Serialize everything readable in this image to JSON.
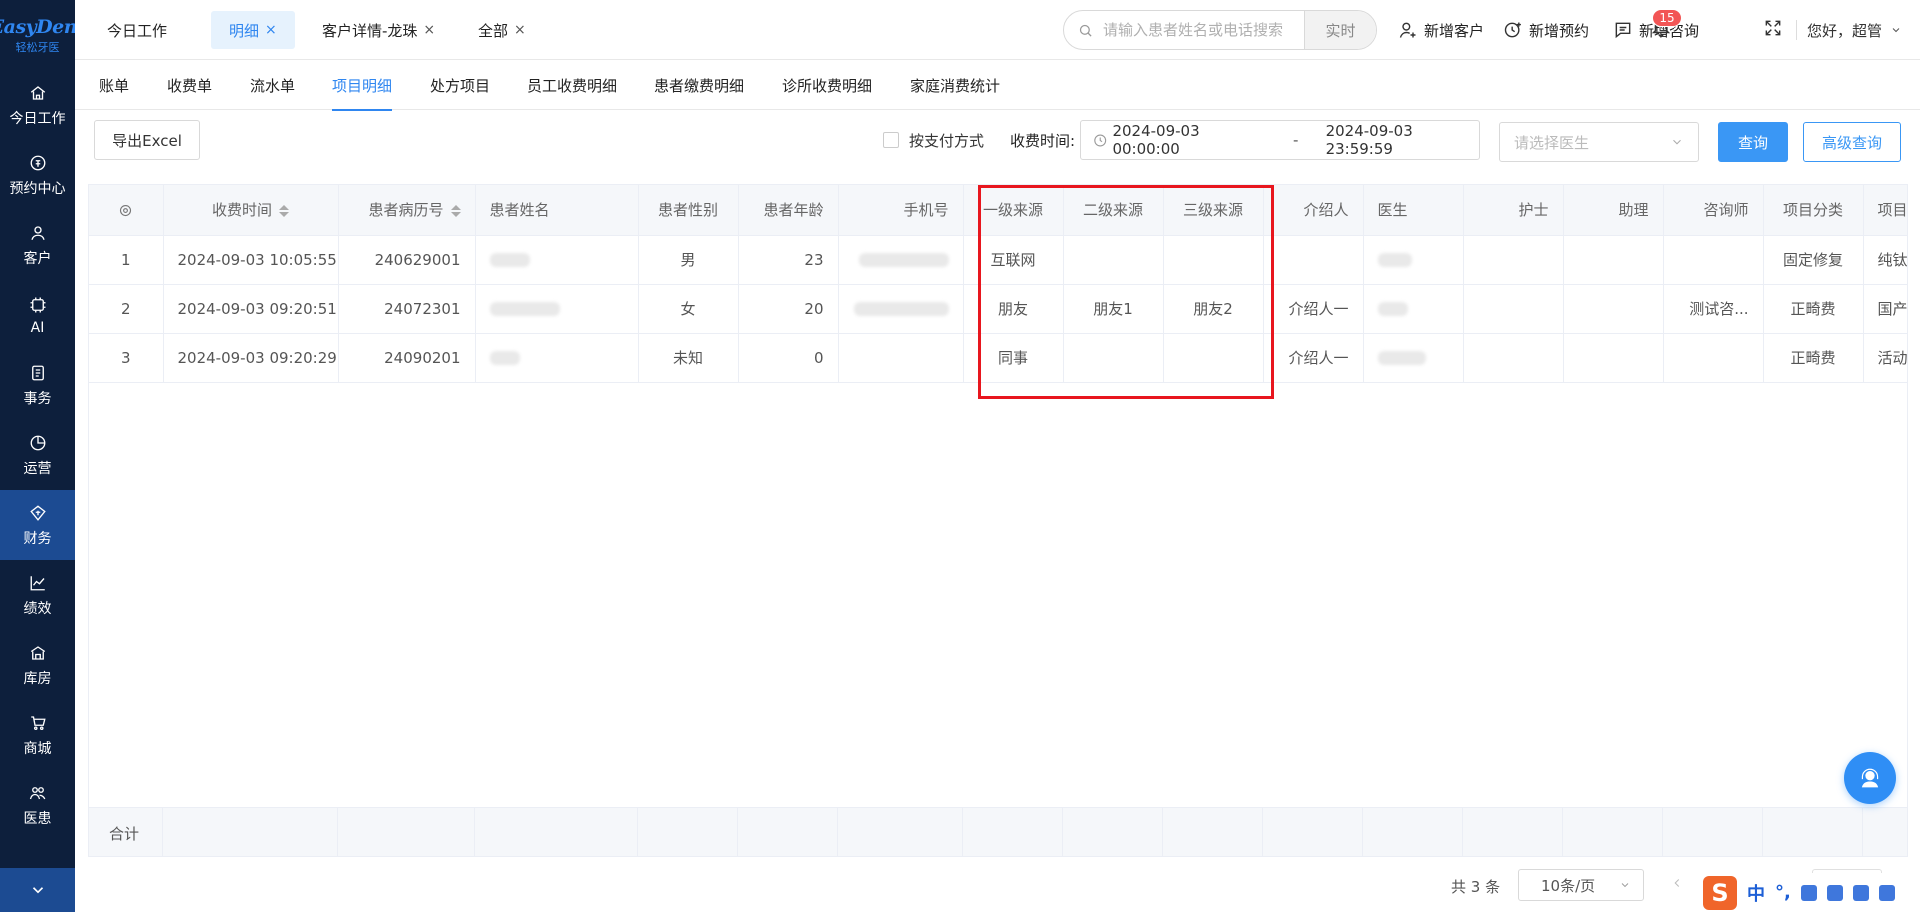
{
  "sidebar": {
    "logo_text": "EasyDent",
    "logo_sub": "轻松牙医",
    "items": [
      {
        "label": "今日工作",
        "icon": "home-icon"
      },
      {
        "label": "预约中心",
        "icon": "appointment-icon"
      },
      {
        "label": "客户",
        "icon": "user-icon"
      },
      {
        "label": "AI",
        "icon": "ai-icon"
      },
      {
        "label": "事务",
        "icon": "task-icon"
      },
      {
        "label": "运营",
        "icon": "pie-chart-icon"
      },
      {
        "label": "财务",
        "icon": "finance-icon",
        "active": true
      },
      {
        "label": "绩效",
        "icon": "line-chart-icon"
      },
      {
        "label": "库房",
        "icon": "warehouse-icon"
      },
      {
        "label": "商城",
        "icon": "cart-icon"
      },
      {
        "label": "医患",
        "icon": "doctor-patient-icon"
      }
    ]
  },
  "topbar": {
    "tabs": [
      {
        "label": "今日工作",
        "closable": false,
        "active": false
      },
      {
        "label": "明细",
        "closable": true,
        "active": true
      },
      {
        "label": "客户详情-龙珠",
        "closable": true,
        "active": false
      },
      {
        "label": "全部",
        "closable": true,
        "active": false
      }
    ],
    "close_glyph": "×",
    "search": {
      "placeholder": "请输入患者姓名或电话搜索",
      "button": "实时"
    },
    "actions": {
      "add_customer": "新增客户",
      "add_appointment": "新增预约",
      "add_consult": "新增咨询"
    },
    "notification_count": "15",
    "greeting": "您好，超管"
  },
  "subtabs": [
    {
      "label": "账单",
      "active": false
    },
    {
      "label": "收费单",
      "active": false
    },
    {
      "label": "流水单",
      "active": false
    },
    {
      "label": "项目明细",
      "active": true
    },
    {
      "label": "处方项目",
      "active": false
    },
    {
      "label": "员工收费明细",
      "active": false
    },
    {
      "label": "患者缴费明细",
      "active": false
    },
    {
      "label": "诊所收费明细",
      "active": false
    },
    {
      "label": "家庭消费统计",
      "active": false
    }
  ],
  "toolbar": {
    "export": "导出Excel",
    "by_payment_method": "按支付方式",
    "time_label": "收费时间:",
    "start_time": "2024-09-03 00:00:00",
    "range_sep": "-",
    "end_time": "2024-09-03 23:59:59",
    "doctor_placeholder": "请选择医生",
    "query": "查询",
    "advanced_query": "高级查询"
  },
  "table": {
    "headers": [
      "收费时间",
      "患者病历号",
      "患者姓名",
      "患者性别",
      "患者年龄",
      "手机号",
      "一级来源",
      "二级来源",
      "三级来源",
      "介绍人",
      "医生",
      "护士",
      "助理",
      "咨询师",
      "项目分类",
      "项目"
    ],
    "header_short_last": "项目",
    "rows": [
      {
        "index": "1",
        "time": "2024-09-03 10:05:55",
        "record_no": "240629001",
        "gender": "男",
        "age": "23",
        "source1": "互联网",
        "source2": "",
        "source3": "",
        "referrer": "",
        "nurse": "",
        "assistant": "",
        "consultant": "",
        "category": "固定修复",
        "item": "纯钛"
      },
      {
        "index": "2",
        "time": "2024-09-03 09:20:51",
        "record_no": "24072301",
        "gender": "女",
        "age": "20",
        "source1": "朋友",
        "source2": "朋友1",
        "source3": "朋友2",
        "referrer": "介绍人一",
        "nurse": "",
        "assistant": "",
        "consultant": "测试咨...",
        "category": "正畸费",
        "item": "国产"
      },
      {
        "index": "3",
        "time": "2024-09-03 09:20:29",
        "record_no": "24090201",
        "gender": "未知",
        "age": "0",
        "source1": "同事",
        "source2": "",
        "source3": "",
        "referrer": "介绍人一",
        "nurse": "",
        "assistant": "",
        "consultant": "",
        "category": "正畸费",
        "item": "活动"
      }
    ],
    "total_label": "合计"
  },
  "pagination": {
    "total": "共 3 条",
    "page_size": "10条/页"
  },
  "ime": {
    "logo": "S",
    "lang": "中",
    "punct": "°,"
  },
  "colors": {
    "sidebar_bg": "#0d1f3c",
    "sidebar_active": "#1c4b92",
    "primary": "#3a97f5",
    "highlight_box": "#e8161e",
    "badge": "#f25555"
  }
}
